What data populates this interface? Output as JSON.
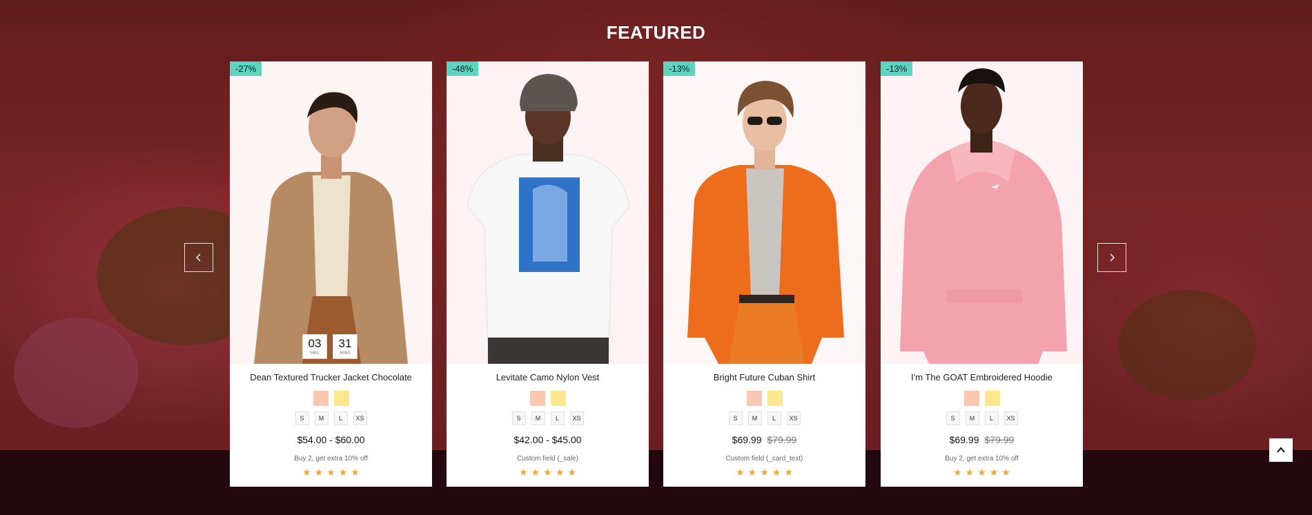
{
  "section": {
    "title": "FEATURED"
  },
  "nav": {
    "prev_icon": "chevron-left-icon",
    "next_icon": "chevron-right-icon",
    "back_to_top_icon": "chevron-up-icon"
  },
  "colors": {
    "badge": "#5ad6c0",
    "star": "#f2a633",
    "swatch_peach": "#fcc7b1",
    "swatch_yellow": "#fbe88e",
    "hero_bg": "#6a1f22"
  },
  "products": [
    {
      "badge": "-27%",
      "title": "Dean Textured Trucker Jacket Chocolate",
      "countdown": {
        "hours": "03",
        "hours_label": "HRS",
        "mins": "31",
        "mins_label": "MINS"
      },
      "swatches": [
        "#fcc7b1",
        "#fbe88e"
      ],
      "sizes": [
        "S",
        "M",
        "L",
        "XS"
      ],
      "price": "$54.00 - $60.00",
      "old_price": "",
      "note": "Buy 2, get extra 10% off",
      "rating": 5
    },
    {
      "badge": "-48%",
      "title": "Levitate Camo Nylon Vest",
      "swatches": [
        "#fcc7b1",
        "#fbe88e"
      ],
      "sizes": [
        "S",
        "M",
        "L",
        "XS"
      ],
      "price": "$42.00 - $45.00",
      "old_price": "",
      "note": "Custom field (_sale)",
      "rating": 5
    },
    {
      "badge": "-13%",
      "title": "Bright Future Cuban Shirt",
      "swatches": [
        "#fcc7b1",
        "#fbe88e"
      ],
      "sizes": [
        "S",
        "M",
        "L",
        "XS"
      ],
      "price": "$69.99",
      "old_price": "$79.99",
      "note": "Custom field (_card_text)",
      "rating": 5
    },
    {
      "badge": "-13%",
      "title": "I'm The GOAT Embroidered Hoodie",
      "swatches": [
        "#fcc7b1",
        "#fbe88e"
      ],
      "sizes": [
        "S",
        "M",
        "L",
        "XS"
      ],
      "price": "$69.99",
      "old_price": "$79.99",
      "note": "Buy 2, get extra 10% off",
      "rating": 5
    }
  ]
}
